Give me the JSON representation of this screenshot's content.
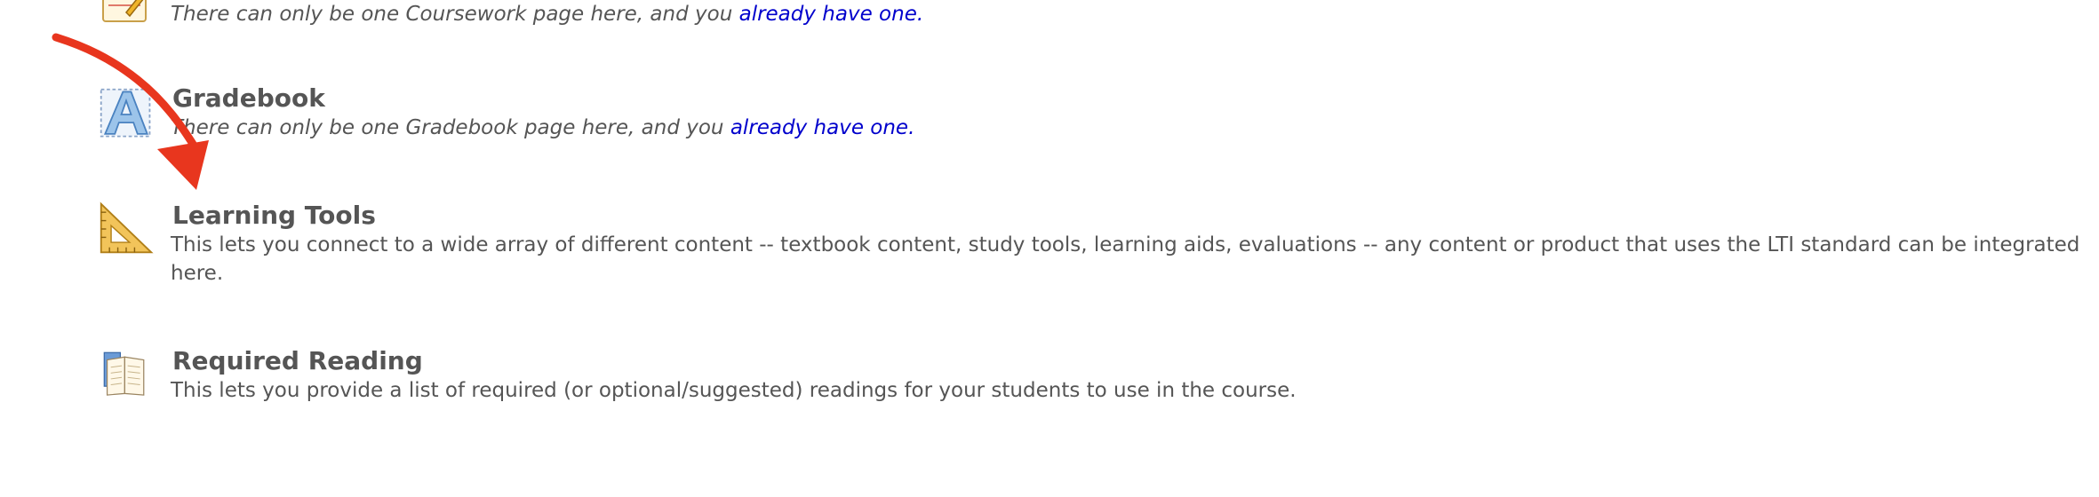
{
  "items": [
    {
      "key": "coursework",
      "title": "",
      "desc_prefix": "There can only be one Coursework page here, and you ",
      "link": "already have one.",
      "icon": "coursework-notepad-icon"
    },
    {
      "key": "gradebook",
      "title": "Gradebook",
      "desc_prefix": "There can only be one Gradebook page here, and you ",
      "link": "already have one.",
      "icon": "gradebook-letter-a-icon"
    },
    {
      "key": "learning-tools",
      "title": "Learning Tools",
      "desc": "This lets you connect to a wide array of different content -- textbook content, study tools, learning aids, evaluations -- any content or product that uses the LTI standard can be integrated here.",
      "icon": "set-square-ruler-icon"
    },
    {
      "key": "required-reading",
      "title": "Required Reading",
      "desc": "This lets you provide a list of required (or optional/suggested) readings for your students to use in the course.",
      "icon": "open-book-icon"
    }
  ],
  "colors": {
    "text": "#555555",
    "link": "#0000cc",
    "annotation_arrow": "#e8361e"
  }
}
